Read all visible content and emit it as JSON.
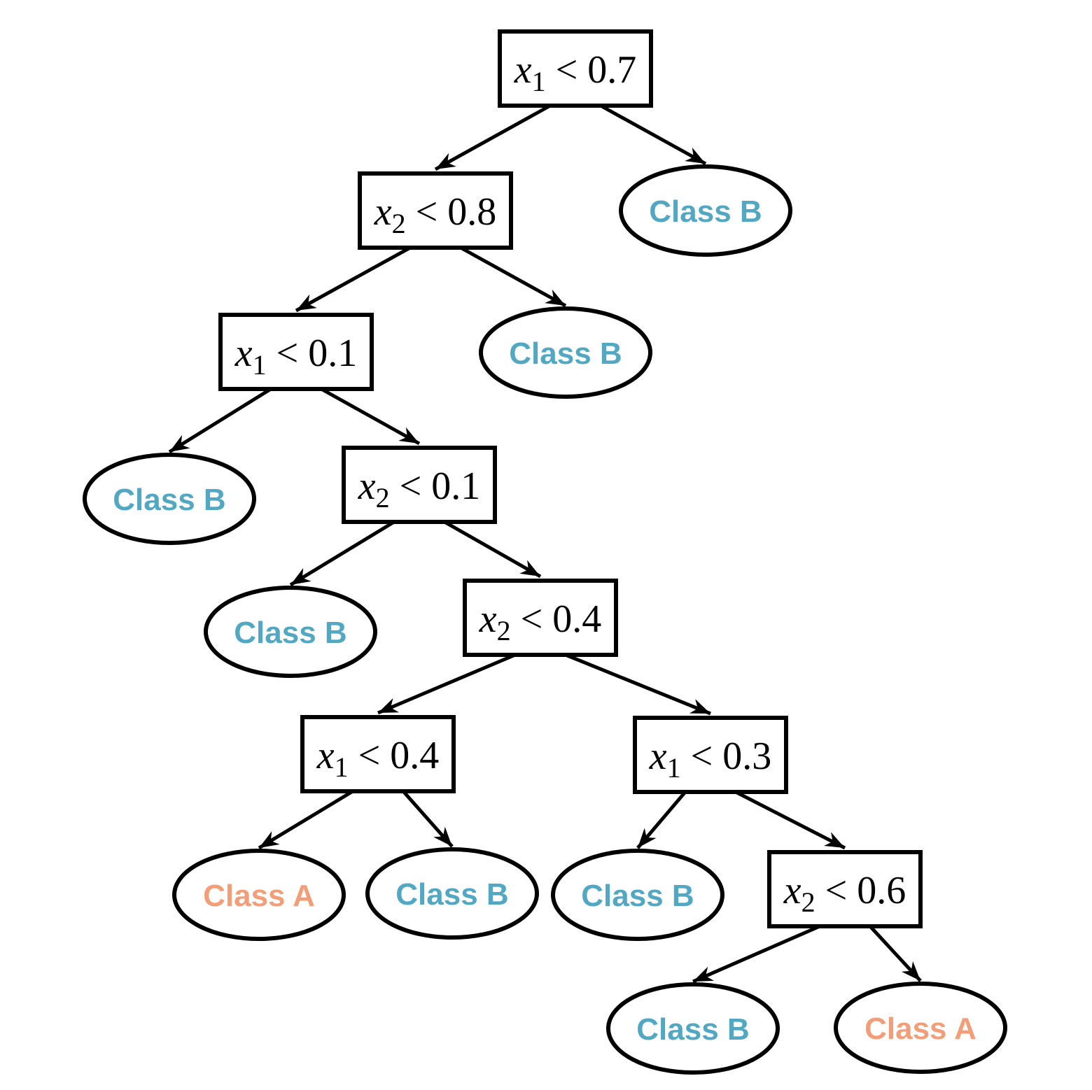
{
  "colors": {
    "class_a": "#F29E78",
    "class_b": "#52A8C3",
    "stroke": "#000000"
  },
  "nodes": [
    {
      "id": "n0",
      "type": "split",
      "var": "x",
      "sub": "1",
      "op": "<",
      "threshold": "0.7"
    },
    {
      "id": "n1",
      "type": "split",
      "var": "x",
      "sub": "2",
      "op": "<",
      "threshold": "0.8"
    },
    {
      "id": "l0",
      "type": "leaf",
      "label": "Class B",
      "cls": "class_b"
    },
    {
      "id": "n2",
      "type": "split",
      "var": "x",
      "sub": "1",
      "op": "<",
      "threshold": "0.1"
    },
    {
      "id": "l1",
      "type": "leaf",
      "label": "Class B",
      "cls": "class_b"
    },
    {
      "id": "l2",
      "type": "leaf",
      "label": "Class B",
      "cls": "class_b"
    },
    {
      "id": "n3",
      "type": "split",
      "var": "x",
      "sub": "2",
      "op": "<",
      "threshold": "0.1"
    },
    {
      "id": "l3",
      "type": "leaf",
      "label": "Class B",
      "cls": "class_b"
    },
    {
      "id": "n4",
      "type": "split",
      "var": "x",
      "sub": "2",
      "op": "<",
      "threshold": "0.4"
    },
    {
      "id": "n5",
      "type": "split",
      "var": "x",
      "sub": "1",
      "op": "<",
      "threshold": "0.4"
    },
    {
      "id": "n6",
      "type": "split",
      "var": "x",
      "sub": "1",
      "op": "<",
      "threshold": "0.3"
    },
    {
      "id": "l4",
      "type": "leaf",
      "label": "Class A",
      "cls": "class_a"
    },
    {
      "id": "l5",
      "type": "leaf",
      "label": "Class B",
      "cls": "class_b"
    },
    {
      "id": "l6",
      "type": "leaf",
      "label": "Class B",
      "cls": "class_b"
    },
    {
      "id": "n7",
      "type": "split",
      "var": "x",
      "sub": "2",
      "op": "<",
      "threshold": "0.6"
    },
    {
      "id": "l7",
      "type": "leaf",
      "label": "Class B",
      "cls": "class_b"
    },
    {
      "id": "l8",
      "type": "leaf",
      "label": "Class A",
      "cls": "class_a"
    }
  ],
  "edges": [
    [
      "n0",
      "n1"
    ],
    [
      "n0",
      "l0"
    ],
    [
      "n1",
      "n2"
    ],
    [
      "n1",
      "l1"
    ],
    [
      "n2",
      "l2"
    ],
    [
      "n2",
      "n3"
    ],
    [
      "n3",
      "l3"
    ],
    [
      "n3",
      "n4"
    ],
    [
      "n4",
      "n5"
    ],
    [
      "n4",
      "n6"
    ],
    [
      "n5",
      "l4"
    ],
    [
      "n5",
      "l5"
    ],
    [
      "n6",
      "l6"
    ],
    [
      "n6",
      "n7"
    ],
    [
      "n7",
      "l7"
    ],
    [
      "n7",
      "l8"
    ]
  ]
}
